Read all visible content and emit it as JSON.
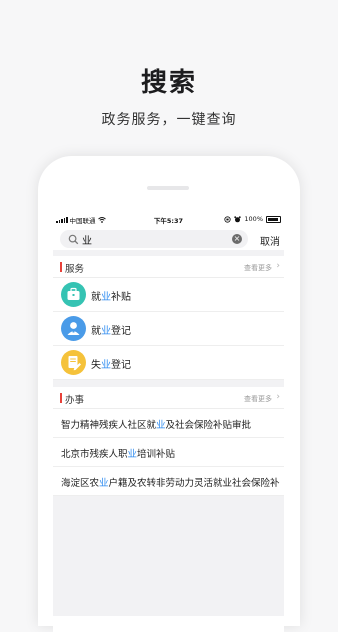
{
  "hero": {
    "title": "搜索",
    "subtitle": "政务服务，一键查询"
  },
  "status_bar": {
    "carrier": "中国联通",
    "time": "下午5:37",
    "battery": "100%"
  },
  "search": {
    "query": "业",
    "cancel_label": "取消"
  },
  "services": {
    "title": "服务",
    "more_label": "查看更多",
    "items": [
      {
        "pre": "就",
        "hl": "业",
        "post": "补贴",
        "icon": "briefcase-icon",
        "color": "#35c3b3"
      },
      {
        "pre": "就",
        "hl": "业",
        "post": "登记",
        "icon": "person-icon",
        "color": "#4a9be8"
      },
      {
        "pre": "失",
        "hl": "业",
        "post": "登记",
        "icon": "document-icon",
        "color": "#f5c23a"
      }
    ]
  },
  "tasks": {
    "title": "办事",
    "more_label": "查看更多",
    "items": [
      {
        "pre": "智力精神残疾人社区就",
        "hl": "业",
        "post": "及社会保险补贴审批"
      },
      {
        "pre": "北京市残疾人职",
        "hl": "业",
        "post": "培训补贴"
      },
      {
        "pre": "海淀区农",
        "hl": "业",
        "post": "户籍及农转非劳动力灵活就业社会保险补..."
      }
    ]
  },
  "colors": {
    "accent_highlight": "#2f8cf0",
    "section_marker": "#e8413a"
  }
}
